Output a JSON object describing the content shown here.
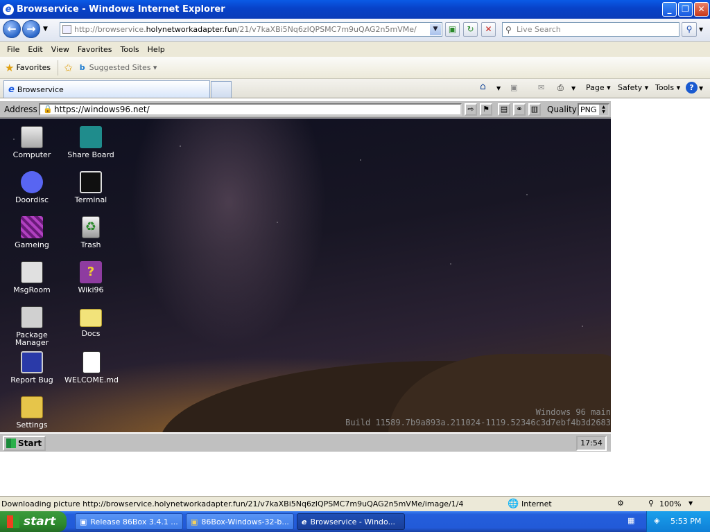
{
  "window": {
    "title": "Browservice - Windows Internet Explorer",
    "controls": [
      "_",
      "❐",
      "✕"
    ]
  },
  "nav": {
    "url_prefix": "http://browservice.",
    "url_host": "holynetworkadapter.fun",
    "url_path": "/21/v7kaXBi5Nq6zIQPSMC7m9uQAG2n5mVMe/",
    "search_placeholder": "Live Search"
  },
  "menu": [
    "File",
    "Edit",
    "View",
    "Favorites",
    "Tools",
    "Help"
  ],
  "favbar": {
    "favorites_label": "Favorites",
    "suggested_label": "Suggested Sites ▾"
  },
  "tabbar": {
    "active_tab": "Browservice",
    "page_label": "Page ▾",
    "safety_label": "Safety ▾",
    "tools_label": "Tools ▾"
  },
  "browservice": {
    "address_label": "Address",
    "url": "https://windows96.net/",
    "quality_label": "Quality",
    "quality_value": "PNG"
  },
  "desktop": {
    "icons": [
      {
        "label": "Computer",
        "color": "#d8d8d8"
      },
      {
        "label": "Share Board",
        "color": "#1f8c8c"
      },
      {
        "label": "Doordisc",
        "color": "#5865f2"
      },
      {
        "label": "Terminal",
        "color": "#101010"
      },
      {
        "label": "Gameing",
        "color": "#8a2a9a"
      },
      {
        "label": "Trash",
        "color": "#c8c8c8"
      },
      {
        "label": "MsgRoom",
        "color": "#e0e0e0"
      },
      {
        "label": "Wiki96",
        "color": "#8e3ca0"
      },
      {
        "label": "Package Manager",
        "color": "#d0d0d0"
      },
      {
        "label": "Docs",
        "color": "#f2e37a"
      },
      {
        "label": "Report Bug",
        "color": "#2a3aa8"
      },
      {
        "label": "WELCOME.md",
        "color": "#ffffff"
      },
      {
        "label": "Settings",
        "color": "#e6c54a"
      }
    ],
    "build_line1": "Windows 96 main",
    "build_line2": "Build 11589.7b9a893a.211024-1119.52346c3d7ebf4b3d2683",
    "start_label": "Start",
    "clock": "17:54"
  },
  "status": {
    "text": "Downloading picture http://browservice.holynetworkadapter.fun/21/v7kaXBi5Nq6zIQPSMC7m9uQAG2n5mVMe/image/1/4",
    "zone": "Internet",
    "zoom": "100%"
  },
  "taskbar": {
    "start_label": "start",
    "buttons": [
      "Release 86Box 3.4.1 ...",
      "86Box-Windows-32-b...",
      "Browservice - Windo..."
    ],
    "time": "5:53 PM"
  }
}
